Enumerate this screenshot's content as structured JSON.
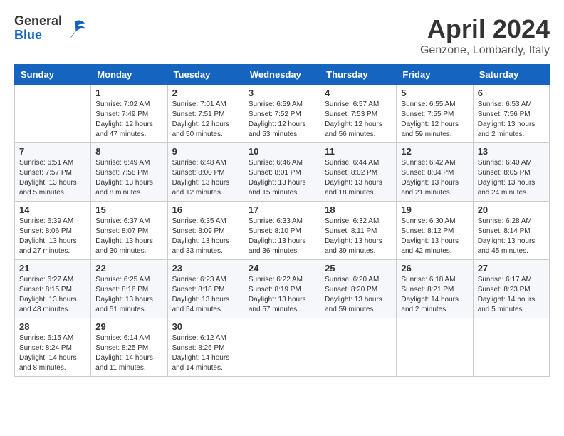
{
  "header": {
    "logo_general": "General",
    "logo_blue": "Blue",
    "month_title": "April 2024",
    "location": "Genzone, Lombardy, Italy"
  },
  "weekdays": [
    "Sunday",
    "Monday",
    "Tuesday",
    "Wednesday",
    "Thursday",
    "Friday",
    "Saturday"
  ],
  "weeks": [
    [
      {
        "day": "",
        "info": ""
      },
      {
        "day": "1",
        "info": "Sunrise: 7:02 AM\nSunset: 7:49 PM\nDaylight: 12 hours\nand 47 minutes."
      },
      {
        "day": "2",
        "info": "Sunrise: 7:01 AM\nSunset: 7:51 PM\nDaylight: 12 hours\nand 50 minutes."
      },
      {
        "day": "3",
        "info": "Sunrise: 6:59 AM\nSunset: 7:52 PM\nDaylight: 12 hours\nand 53 minutes."
      },
      {
        "day": "4",
        "info": "Sunrise: 6:57 AM\nSunset: 7:53 PM\nDaylight: 12 hours\nand 56 minutes."
      },
      {
        "day": "5",
        "info": "Sunrise: 6:55 AM\nSunset: 7:55 PM\nDaylight: 12 hours\nand 59 minutes."
      },
      {
        "day": "6",
        "info": "Sunrise: 6:53 AM\nSunset: 7:56 PM\nDaylight: 13 hours\nand 2 minutes."
      }
    ],
    [
      {
        "day": "7",
        "info": "Sunrise: 6:51 AM\nSunset: 7:57 PM\nDaylight: 13 hours\nand 5 minutes."
      },
      {
        "day": "8",
        "info": "Sunrise: 6:49 AM\nSunset: 7:58 PM\nDaylight: 13 hours\nand 8 minutes."
      },
      {
        "day": "9",
        "info": "Sunrise: 6:48 AM\nSunset: 8:00 PM\nDaylight: 13 hours\nand 12 minutes."
      },
      {
        "day": "10",
        "info": "Sunrise: 6:46 AM\nSunset: 8:01 PM\nDaylight: 13 hours\nand 15 minutes."
      },
      {
        "day": "11",
        "info": "Sunrise: 6:44 AM\nSunset: 8:02 PM\nDaylight: 13 hours\nand 18 minutes."
      },
      {
        "day": "12",
        "info": "Sunrise: 6:42 AM\nSunset: 8:04 PM\nDaylight: 13 hours\nand 21 minutes."
      },
      {
        "day": "13",
        "info": "Sunrise: 6:40 AM\nSunset: 8:05 PM\nDaylight: 13 hours\nand 24 minutes."
      }
    ],
    [
      {
        "day": "14",
        "info": "Sunrise: 6:39 AM\nSunset: 8:06 PM\nDaylight: 13 hours\nand 27 minutes."
      },
      {
        "day": "15",
        "info": "Sunrise: 6:37 AM\nSunset: 8:07 PM\nDaylight: 13 hours\nand 30 minutes."
      },
      {
        "day": "16",
        "info": "Sunrise: 6:35 AM\nSunset: 8:09 PM\nDaylight: 13 hours\nand 33 minutes."
      },
      {
        "day": "17",
        "info": "Sunrise: 6:33 AM\nSunset: 8:10 PM\nDaylight: 13 hours\nand 36 minutes."
      },
      {
        "day": "18",
        "info": "Sunrise: 6:32 AM\nSunset: 8:11 PM\nDaylight: 13 hours\nand 39 minutes."
      },
      {
        "day": "19",
        "info": "Sunrise: 6:30 AM\nSunset: 8:12 PM\nDaylight: 13 hours\nand 42 minutes."
      },
      {
        "day": "20",
        "info": "Sunrise: 6:28 AM\nSunset: 8:14 PM\nDaylight: 13 hours\nand 45 minutes."
      }
    ],
    [
      {
        "day": "21",
        "info": "Sunrise: 6:27 AM\nSunset: 8:15 PM\nDaylight: 13 hours\nand 48 minutes."
      },
      {
        "day": "22",
        "info": "Sunrise: 6:25 AM\nSunset: 8:16 PM\nDaylight: 13 hours\nand 51 minutes."
      },
      {
        "day": "23",
        "info": "Sunrise: 6:23 AM\nSunset: 8:18 PM\nDaylight: 13 hours\nand 54 minutes."
      },
      {
        "day": "24",
        "info": "Sunrise: 6:22 AM\nSunset: 8:19 PM\nDaylight: 13 hours\nand 57 minutes."
      },
      {
        "day": "25",
        "info": "Sunrise: 6:20 AM\nSunset: 8:20 PM\nDaylight: 13 hours\nand 59 minutes."
      },
      {
        "day": "26",
        "info": "Sunrise: 6:18 AM\nSunset: 8:21 PM\nDaylight: 14 hours\nand 2 minutes."
      },
      {
        "day": "27",
        "info": "Sunrise: 6:17 AM\nSunset: 8:23 PM\nDaylight: 14 hours\nand 5 minutes."
      }
    ],
    [
      {
        "day": "28",
        "info": "Sunrise: 6:15 AM\nSunset: 8:24 PM\nDaylight: 14 hours\nand 8 minutes."
      },
      {
        "day": "29",
        "info": "Sunrise: 6:14 AM\nSunset: 8:25 PM\nDaylight: 14 hours\nand 11 minutes."
      },
      {
        "day": "30",
        "info": "Sunrise: 6:12 AM\nSunset: 8:26 PM\nDaylight: 14 hours\nand 14 minutes."
      },
      {
        "day": "",
        "info": ""
      },
      {
        "day": "",
        "info": ""
      },
      {
        "day": "",
        "info": ""
      },
      {
        "day": "",
        "info": ""
      }
    ]
  ]
}
